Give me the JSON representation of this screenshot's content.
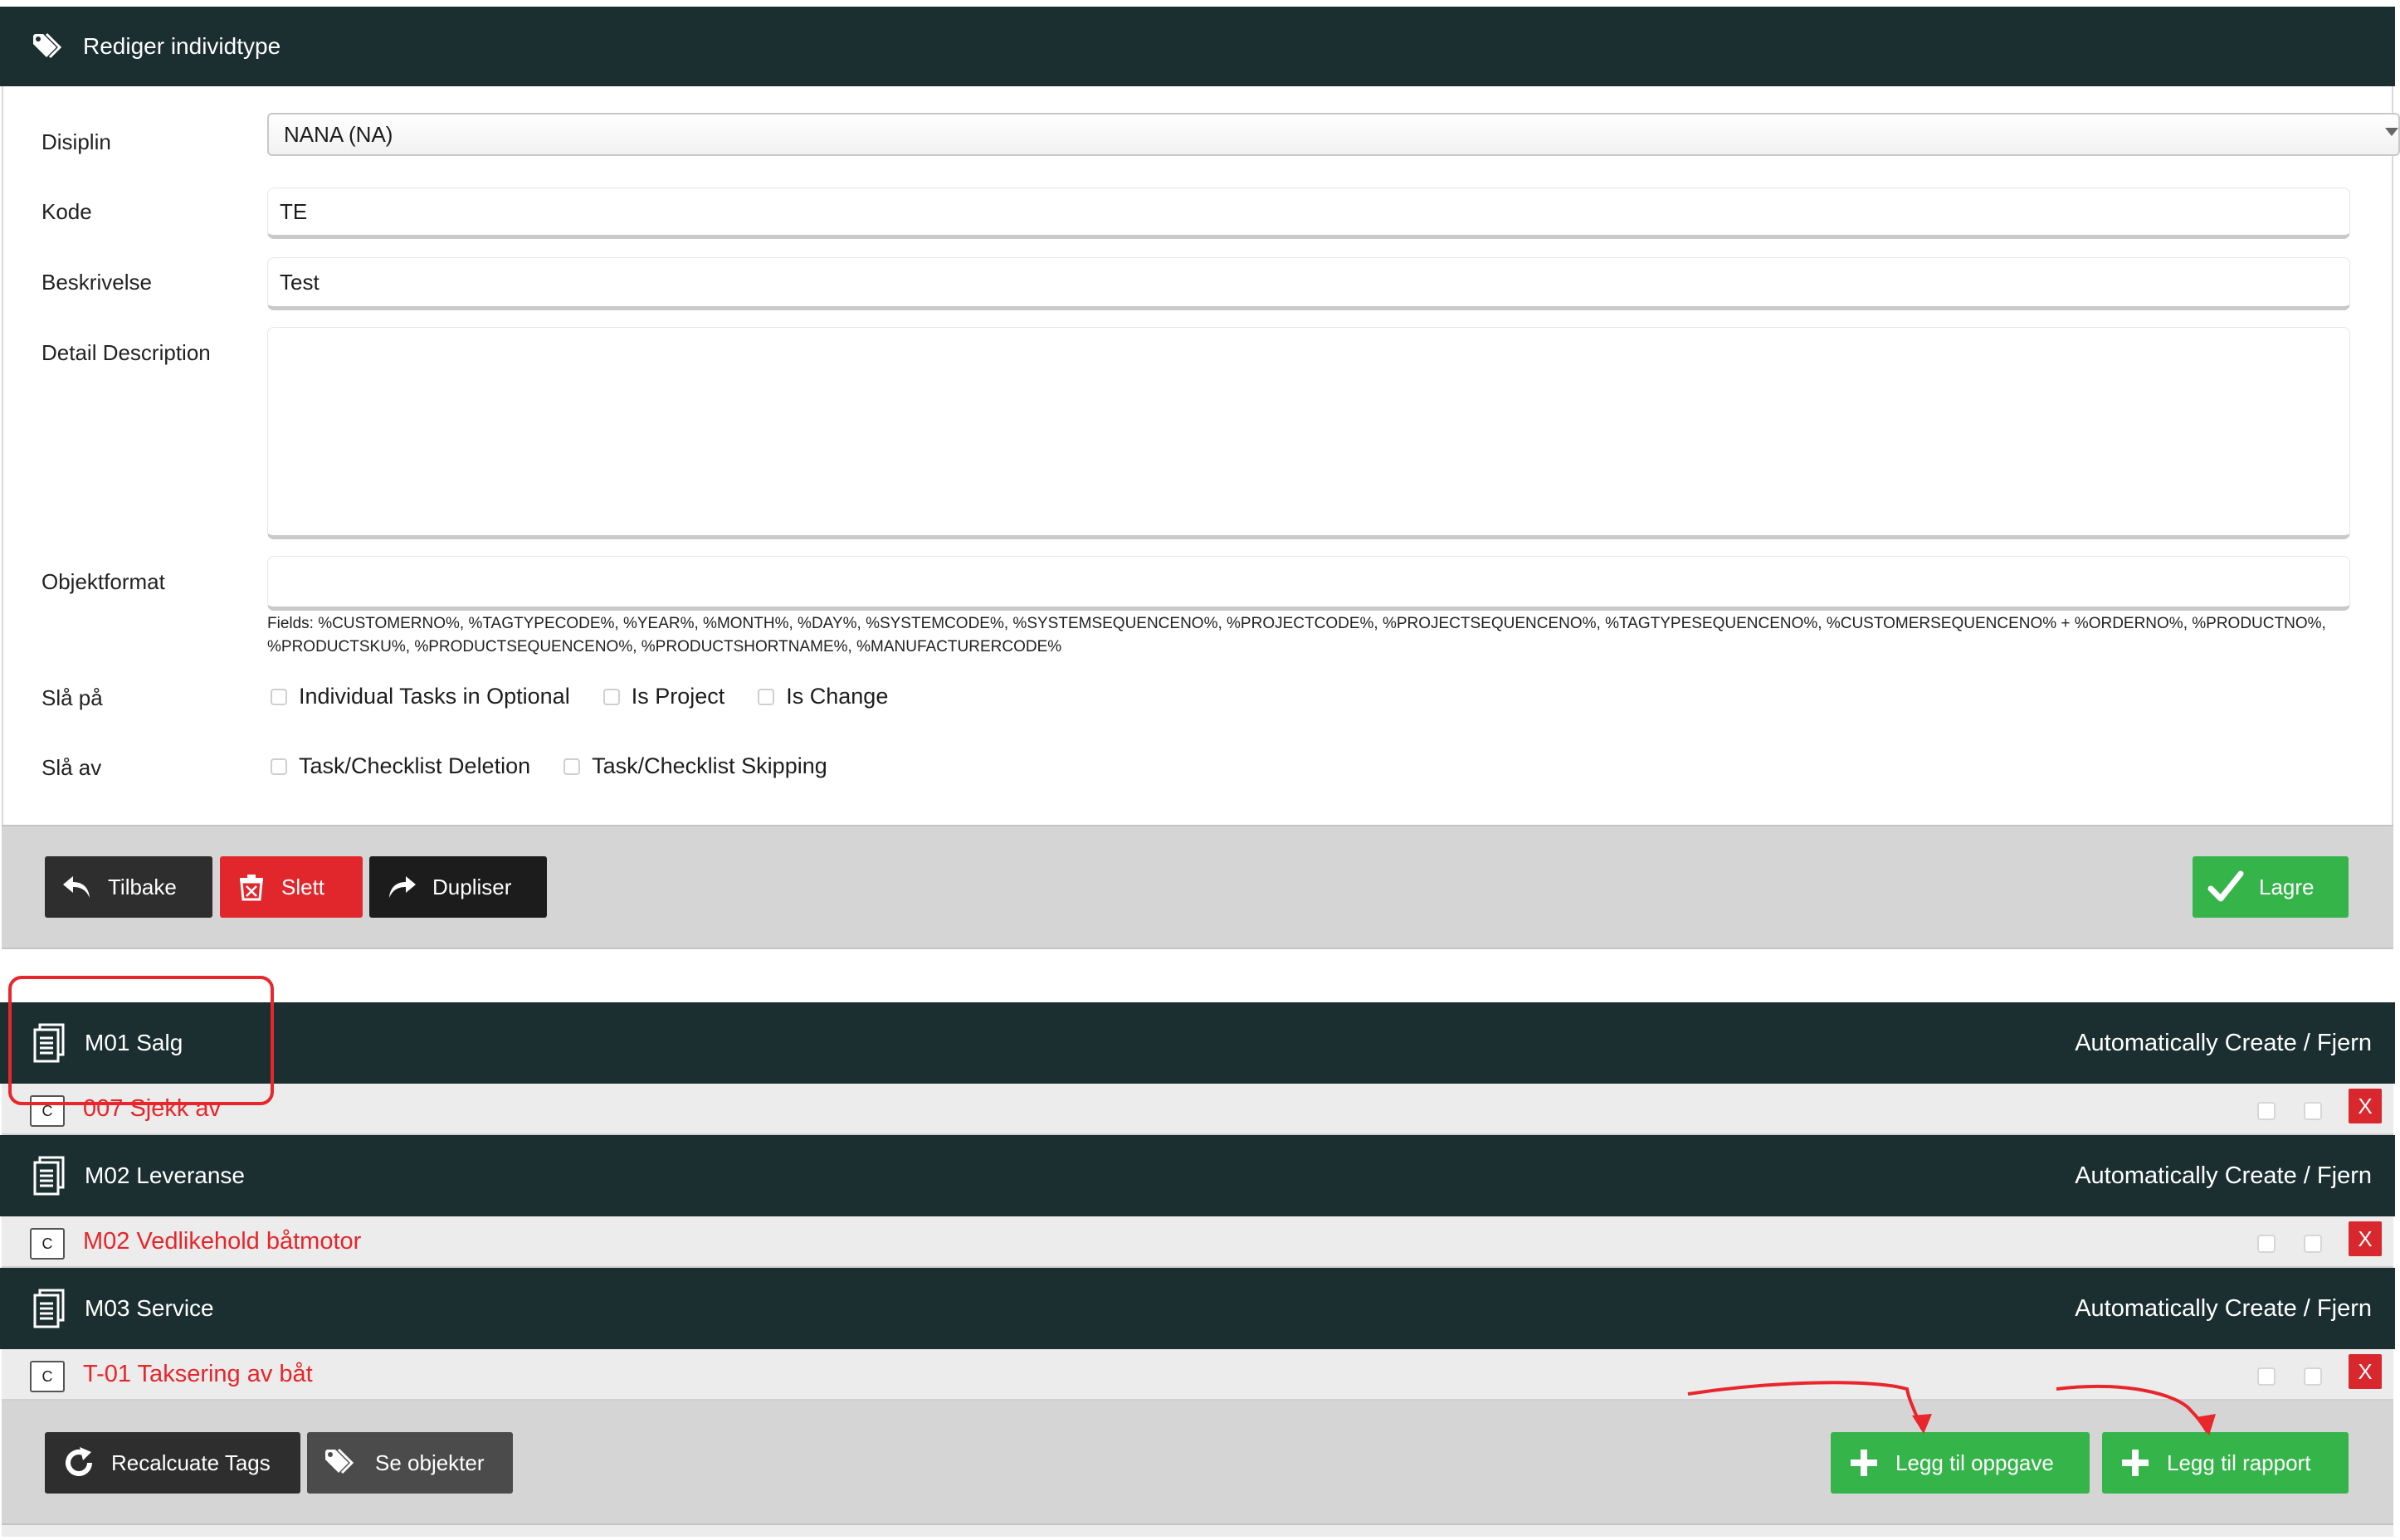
{
  "header": {
    "title": "Rediger individtype",
    "icon": "tag-icon"
  },
  "form": {
    "disiplin": {
      "label": "Disiplin",
      "value": "NANA (NA)"
    },
    "kode": {
      "label": "Kode",
      "value": "TE"
    },
    "beskrivelse": {
      "label": "Beskrivelse",
      "value": "Test"
    },
    "detail_description": {
      "label": "Detail Description",
      "value": ""
    },
    "objektformat": {
      "label": "Objektformat",
      "value": "",
      "hint": "Fields: %CUSTOMERNO%, %TAGTYPECODE%, %YEAR%, %MONTH%, %DAY%, %SYSTEMCODE%, %SYSTEMSEQUENCENO%, %PROJECTCODE%, %PROJECTSEQUENCENO%, %TAGTYPESEQUENCENO%, %CUSTOMERSEQUENCENO% + %ORDERNO%, %PRODUCTNO%, %PRODUCTSKU%, %PRODUCTSEQUENCENO%, %PRODUCTSHORTNAME%, %MANUFACTURERCODE%"
    },
    "sla_pa": {
      "label": "Slå på",
      "options": [
        "Individual Tasks in Optional",
        "Is Project",
        "Is Change"
      ]
    },
    "sla_av": {
      "label": "Slå av",
      "options": [
        "Task/Checklist Deletion",
        "Task/Checklist Skipping"
      ]
    }
  },
  "actions": {
    "tilbake": "Tilbake",
    "slett": "Slett",
    "dupliser": "Dupliser",
    "lagre": "Lagre"
  },
  "sections": [
    {
      "title": "M01 Salg",
      "right_label": "Automatically Create / Fjern",
      "item": {
        "code_button": "C",
        "name": "007 Sjekk av",
        "remove": "X"
      }
    },
    {
      "title": "M02 Leveranse",
      "right_label": "Automatically Create / Fjern",
      "item": {
        "code_button": "C",
        "name": "M02 Vedlikehold båtmotor",
        "remove": "X"
      }
    },
    {
      "title": "M03 Service",
      "right_label": "Automatically Create / Fjern",
      "item": {
        "code_button": "C",
        "name": "T-01 Taksering av båt",
        "remove": "X"
      }
    }
  ],
  "footer": {
    "recalculate": "Recalcuate Tags",
    "se_objekter": "Se objekter",
    "legg_til_oppgave": "Legg til oppgave",
    "legg_til_rapport": "Legg til rapport"
  },
  "colors": {
    "header_bg": "#1b2f31",
    "danger": "#e2272c",
    "success": "#35b44a",
    "link_red": "#e5262b",
    "annotation_red": "#e8262b"
  }
}
